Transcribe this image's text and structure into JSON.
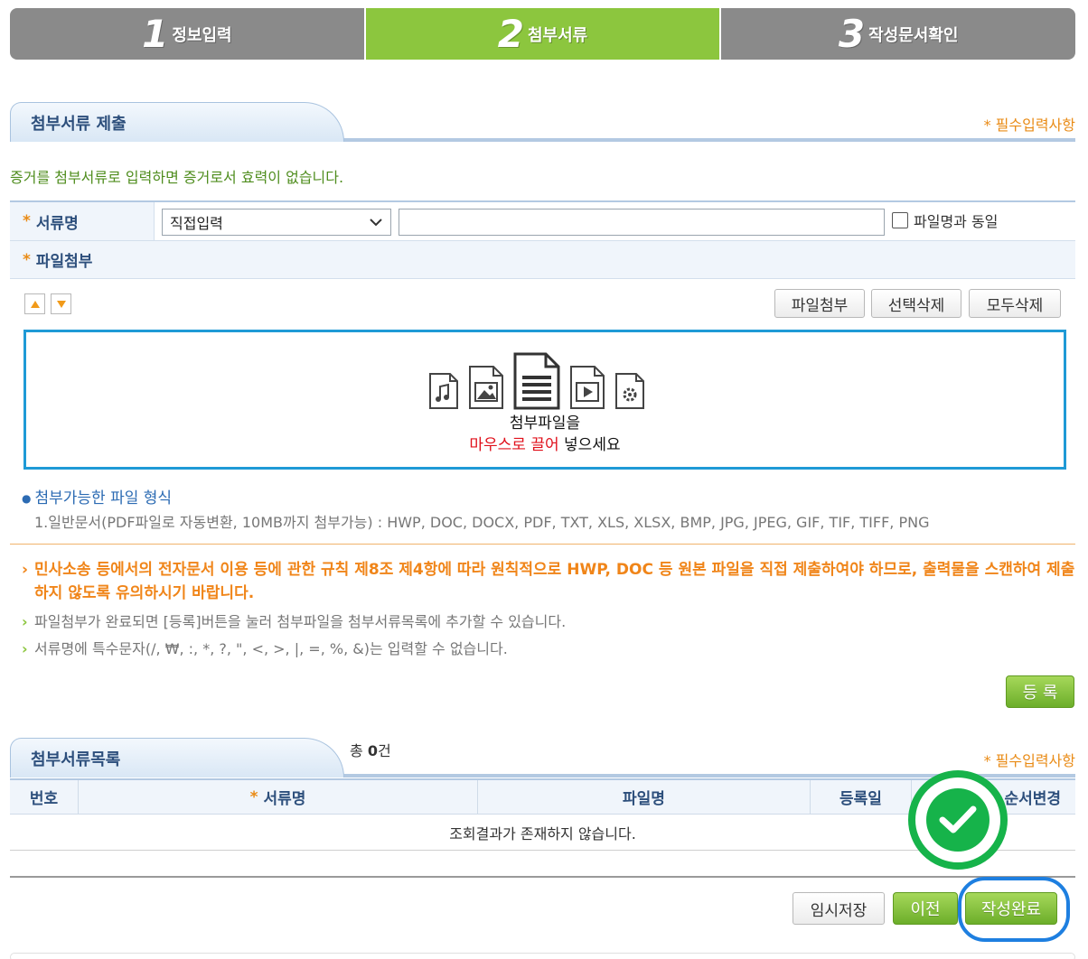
{
  "steps": [
    {
      "num": "1",
      "label": "정보입력",
      "active": false
    },
    {
      "num": "2",
      "label": "첨부서류",
      "active": true
    },
    {
      "num": "3",
      "label": "작성문서확인",
      "active": false
    }
  ],
  "section1": {
    "title": "첨부서류 제출",
    "required_note": "* 필수입력사항",
    "notice": "증거를 첨부서류로 입력하면 증거로서 효력이 없습니다."
  },
  "form": {
    "doc_name_label": "서류명",
    "select_value": "직접입력",
    "same_as_filename_label": "파일명과 동일",
    "attach_label": "파일첨부",
    "star": "*"
  },
  "buttons": {
    "attach": "파일첨부",
    "delete_selected": "선택삭제",
    "delete_all": "모두삭제",
    "register": "등 록",
    "temp_save": "임시저장",
    "prev": "이전",
    "complete": "작성완료"
  },
  "dropzone": {
    "line1": "첨부파일을",
    "line2_red": "마우스로 끌어",
    "line2_rest": " 넣으세요"
  },
  "file_types": {
    "title": "첨부가능한 파일 형식",
    "desc": "1.일반문서(PDF파일로 자동변환, 10MB까지 첨부가능) : HWP, DOC, DOCX, PDF, TXT, XLS, XLSX, BMP, JPG, JPEG, GIF, TIF, TIFF, PNG"
  },
  "notes": {
    "orange": "민사소송 등에서의 전자문서 이용 등에 관한 규칙 제8조 제4항에 따라 원칙적으로 HWP, DOC 등 원본 파일을 직접 제출하여야 하므로, 출력물을 스캔하여 제출하지 않도록 유의하시기 바랍니다.",
    "grey1": "파일첨부가 완료되면 [등록]버튼을 눌러 첨부파일을 첨부서류목록에 추가할 수 있습니다.",
    "grey2": "서류명에 특수문자(/, ₩, :, *, ?, \", <, >, |, =, %, &)는 입력할 수 없습니다."
  },
  "section2": {
    "title": "첨부서류목록",
    "total_prefix": "총 ",
    "total_count": "0",
    "total_suffix": "건",
    "required_note": "* 필수입력사항",
    "columns": [
      "번호",
      "서류명",
      "파일명",
      "등록일",
      "순서변경"
    ],
    "empty_message": "조회결과가 존재하지 않습니다."
  },
  "colors": {
    "active_step": "#8cc63e",
    "inactive_step": "#8a8a8a",
    "accent_blue": "#1f9ad6",
    "orange": "#f08519",
    "badge_green": "#16b34a"
  }
}
